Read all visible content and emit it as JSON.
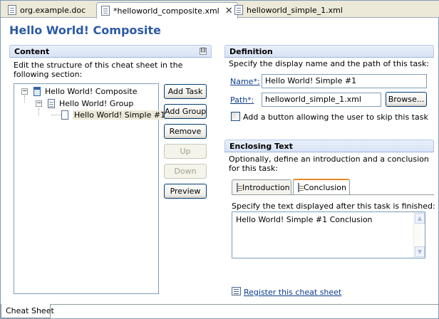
{
  "tabs": [
    {
      "label": "org.example.doc"
    },
    {
      "label": "*helloworld_composite.xml",
      "close": "✕"
    },
    {
      "label": "helloworld_simple_1.xml"
    }
  ],
  "page_title": "Hello World! Composite",
  "content": {
    "header": "Content",
    "collapse_glyph": "⊟",
    "description": "Edit the structure of this cheat sheet in the following section:",
    "tree": [
      {
        "label": "Hello World! Composite",
        "expander": "−"
      },
      {
        "label": "Hello World! Group",
        "expander": "−"
      },
      {
        "label": "Hello World! Simple #1"
      }
    ],
    "buttons": {
      "add_task": "Add Task",
      "add_group": "Add Group",
      "remove": "Remove",
      "up": "Up",
      "down": "Down",
      "preview": "Preview"
    }
  },
  "definition": {
    "header": "Definition",
    "description": "Specify the display name and the path of this task:",
    "name_label": "Name*:",
    "name_value": "Hello World! Simple #1",
    "path_label": "Path*:",
    "path_value": "helloworld_simple_1.xml",
    "browse": "Browse...",
    "skip_label": "Add a button allowing the user to skip this task"
  },
  "enclosing": {
    "header": "Enclosing Text",
    "description": "Optionally, define an introduction and a conclusion for this task:",
    "tabs": [
      "Introduction",
      "Conclusion"
    ],
    "prompt": "Specify the text displayed after this task is finished:",
    "text": "Hello World! Simple #1 Conclusion",
    "scroll_up": "▲",
    "scroll_down": "▼"
  },
  "register_link": "Register this cheat sheet",
  "footer_tab": "Cheat Sheet"
}
